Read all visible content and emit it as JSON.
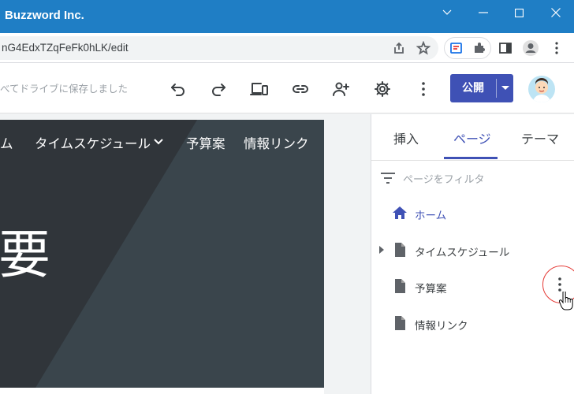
{
  "window": {
    "title": "Buzzword Inc.",
    "buttons": [
      "chevron-down-icon",
      "minimize-icon",
      "maximize-icon",
      "close-icon"
    ]
  },
  "browser": {
    "url": "nG4EdxTZqFeFk0hLK/edit"
  },
  "toolbar": {
    "save_status": "べてドライブに保存しました",
    "publish_label": "公開"
  },
  "site": {
    "nav": [
      "ム",
      "タイムスケジュール",
      "予算案",
      "情報リンク"
    ],
    "hero_text": "要"
  },
  "panel": {
    "tabs": [
      "挿入",
      "ページ",
      "テーマ"
    ],
    "active_tab": "ページ",
    "filter_placeholder": "ページをフィルタ",
    "pages": [
      {
        "label": "ホーム",
        "icon": "home-icon"
      },
      {
        "label": "タイムスケジュール",
        "icon": "page-icon"
      },
      {
        "label": "予算案",
        "icon": "page-icon"
      },
      {
        "label": "情報リンク",
        "icon": "page-icon"
      }
    ]
  },
  "colors": {
    "titlebar": "#1f7ec5",
    "accent": "#3f51b5",
    "hero": "#343b41",
    "highlight": "#e53935"
  }
}
